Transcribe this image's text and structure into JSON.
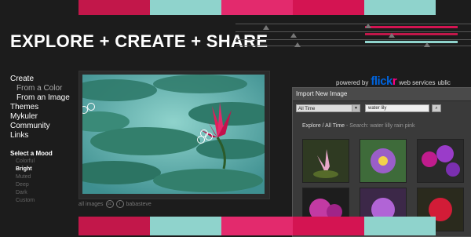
{
  "palette": {
    "top": [
      "#c2174a",
      "#8fd3cc",
      "#e32a6d",
      "#d41452",
      "#8fd3cc"
    ],
    "bottom": [
      "#c2174a",
      "#8fd3cc",
      "#e32a6d",
      "#d41452",
      "#8fd3cc"
    ]
  },
  "headline": "EXPLORE + CREATE + SHARE",
  "nav": {
    "items": [
      {
        "label": "Create",
        "type": "main"
      },
      {
        "label": "From a Color",
        "type": "sub"
      },
      {
        "label": "From an Image",
        "type": "sub-active"
      },
      {
        "label": "Themes",
        "type": "main"
      },
      {
        "label": "Mykuler",
        "type": "main"
      },
      {
        "label": "Community",
        "type": "main"
      },
      {
        "label": "Links",
        "type": "main"
      }
    ]
  },
  "mood": {
    "title": "Select a Mood",
    "options": [
      "Colorful",
      "Bright",
      "Muted",
      "Deep",
      "Dark",
      "Custom"
    ],
    "selected": "Bright"
  },
  "photo_credit": {
    "prefix": "all images",
    "author": "babasteve"
  },
  "powered_by": {
    "text": "powered by",
    "logo_part1": "flick",
    "logo_part2": "r",
    "suffix": "web services",
    "tail": "ublic"
  },
  "dialog": {
    "title": "Import New Image",
    "time_filter": "All Time",
    "search_value": "water lily",
    "caption_main": "Explore / All Time",
    "caption_detail": " - Search: water lilly rain pink"
  }
}
